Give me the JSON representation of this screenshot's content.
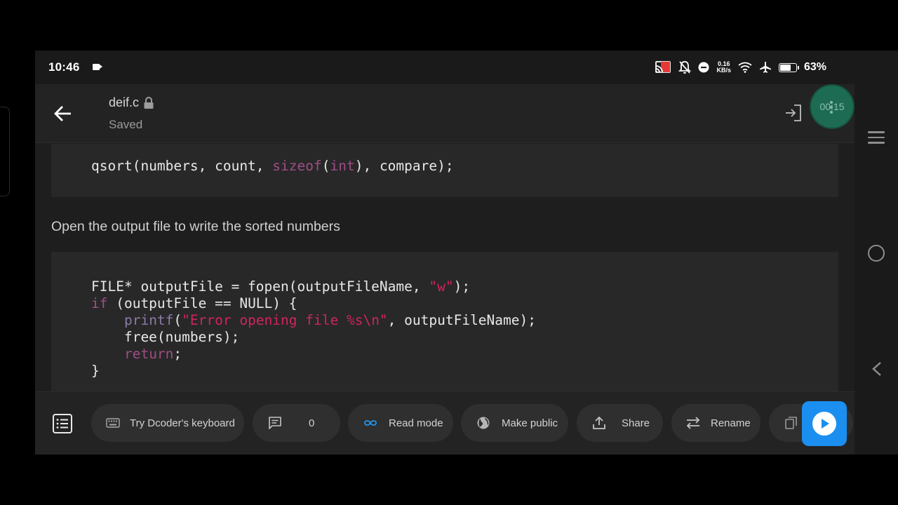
{
  "status_bar": {
    "time": "10:46",
    "net_speed_value": "0.16",
    "net_speed_unit": "KB/s",
    "battery_percent": "63%",
    "battery_level": 0.63
  },
  "header": {
    "file_name": "deif.c",
    "status": "Saved",
    "timer": "00:15"
  },
  "content": {
    "block1_code": "qsort(numbers, count, sizeof(int), compare);",
    "prose": "Open the output file to write the sorted numbers",
    "block2_code": "FILE* outputFile = fopen(outputFileName, \"w\");\nif (outputFile == NULL) {\n    printf(\"Error opening file %s\\n\", outputFileName);\n    free(numbers);\n    return;\n}"
  },
  "toolbar": {
    "keyboard_label": "Try Dcoder's keyboard",
    "comments_count": "0",
    "read_mode_label": "Read mode",
    "make_public_label": "Make public",
    "share_label": "Share",
    "rename_label": "Rename"
  },
  "colors": {
    "run_button": "#1a8ff0",
    "timer_bg": "#1c6b52",
    "keyword": "#9f4d86",
    "string": "#d1245d",
    "read_mode_icon": "#2196f3"
  },
  "icons": [
    "back-arrow-icon",
    "lock-icon",
    "exit-icon",
    "list-icon",
    "keyboard-icon",
    "comment-icon",
    "infinity-icon",
    "globe-icon",
    "share-icon",
    "swap-icon",
    "play-icon",
    "cast-icon",
    "mute-icon",
    "dnd-icon",
    "wifi-icon",
    "airplane-icon",
    "battery-icon",
    "video-icon"
  ]
}
